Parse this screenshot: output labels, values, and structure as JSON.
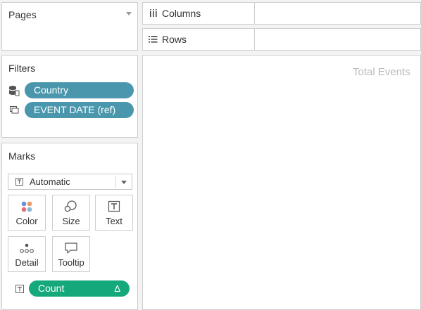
{
  "pages": {
    "title": "Pages"
  },
  "shelves": {
    "columns_label": "Columns",
    "rows_label": "Rows"
  },
  "filters": {
    "title": "Filters",
    "items": [
      {
        "label": "Country",
        "icon": "database-filter-icon"
      },
      {
        "label": "EVENT DATE (ref)",
        "icon": "context-filter-icon"
      }
    ]
  },
  "marks": {
    "title": "Marks",
    "type": {
      "label": "Automatic"
    },
    "buttons": [
      {
        "label": "Color",
        "icon": "color-icon"
      },
      {
        "label": "Size",
        "icon": "size-icon"
      },
      {
        "label": "Text",
        "icon": "text-icon"
      },
      {
        "label": "Detail",
        "icon": "detail-icon"
      },
      {
        "label": "Tooltip",
        "icon": "tooltip-icon"
      }
    ],
    "field": {
      "label": "Count",
      "delta": "Δ"
    }
  },
  "canvas": {
    "title": "Total Events"
  },
  "colors": {
    "filter_pill": "#4a97ad",
    "measure_pill": "#14a87a"
  }
}
